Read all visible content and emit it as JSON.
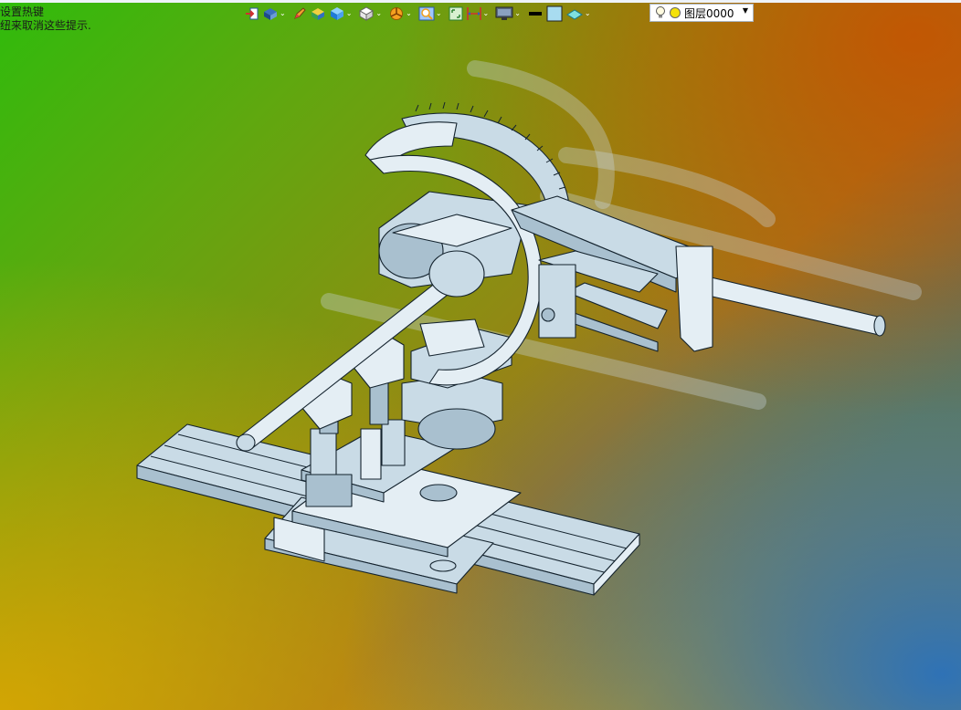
{
  "hint": {
    "line1": "设置热键",
    "line2": "纽来取消这些提示."
  },
  "toolbar": {
    "icons": [
      "import-icon",
      "view-orientation-icon",
      "pencil-icon",
      "box-solid-icon",
      "cube-shade-icon",
      "cube-wire-icon",
      "section-icon",
      "zoom-icon",
      "fit-icon",
      "dimension-icon",
      "monitor-icon",
      "line-color-icon",
      "fill-color-icon",
      "plane-icon"
    ]
  },
  "layer": {
    "name": "图层0000"
  },
  "colors": {
    "part_fill": "#c9dbe6",
    "part_edge": "#14232e",
    "dropdown_bg": "#ffffff"
  }
}
